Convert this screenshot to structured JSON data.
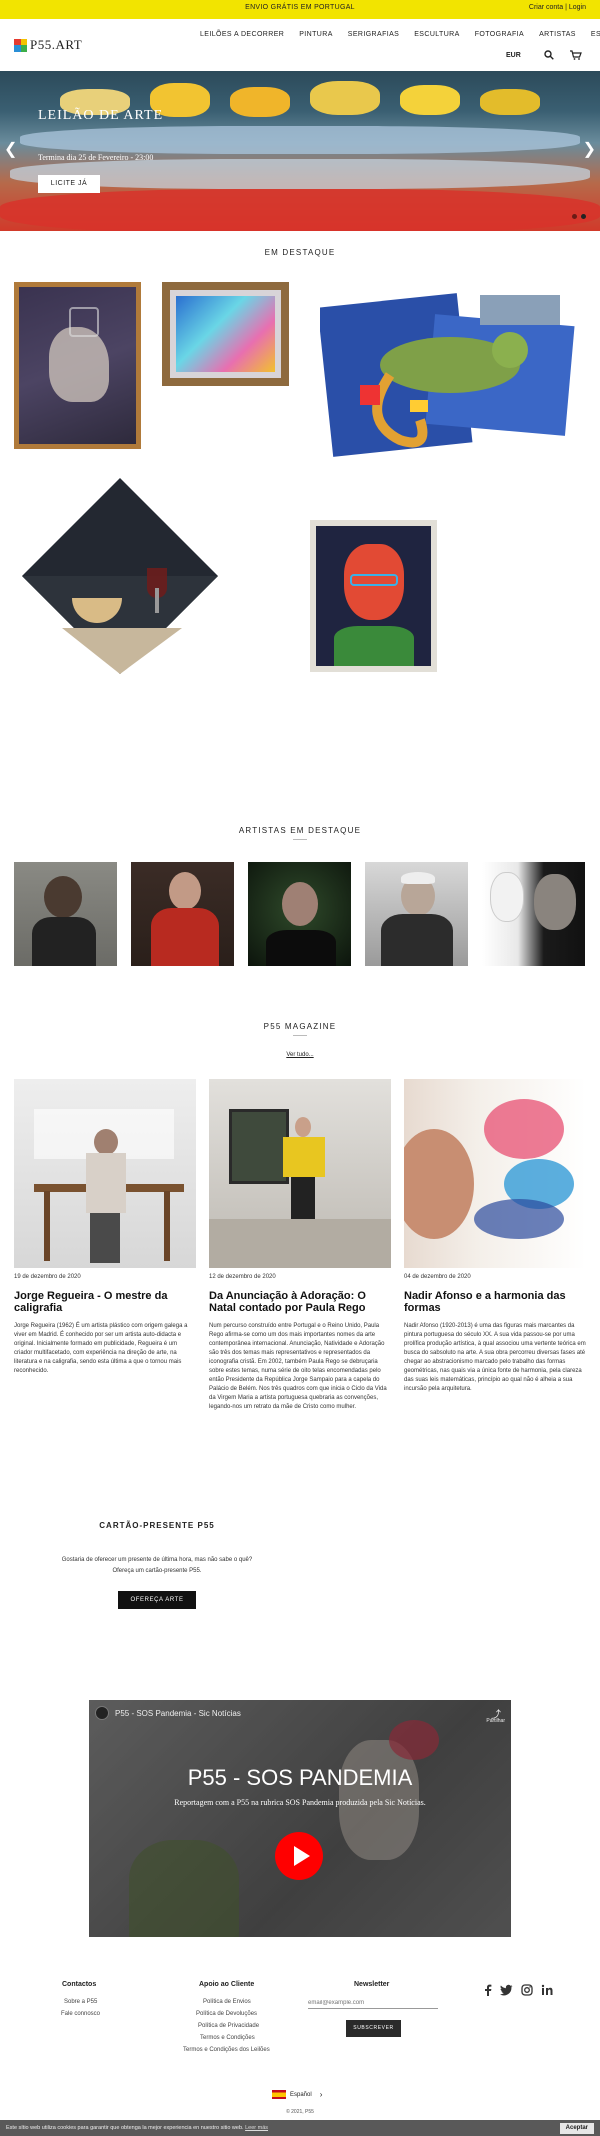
{
  "topbar": {
    "promo": "ENVIO GRÁTIS EM PORTUGAL",
    "create_account": "Criar conta",
    "separator": "|",
    "login": "Login"
  },
  "header": {
    "logo_text": "P55.ART",
    "nav": [
      "LEILÕES A DECORRER",
      "PINTURA",
      "SERIGRAFIAS",
      "ESCULTURA",
      "FOTOGRAFIA",
      "ARTISTAS",
      "ES"
    ],
    "currency": "EUR",
    "icons": [
      "search-icon",
      "cart-icon",
      "chevron-right-icon"
    ]
  },
  "hero": {
    "title": "LEILÃO DE ARTE",
    "subtitle": "Termina dia 25 de Fevereiro - 23:00",
    "button": "LICITE JÁ",
    "prev": "❮",
    "next": "❯",
    "slides": 2,
    "active_slide": 2
  },
  "featured": {
    "title": "EM DESTAQUE"
  },
  "artists": {
    "title": "ARTISTAS EM DESTAQUE"
  },
  "magazine": {
    "title": "P55 MAGAZINE",
    "see_all": "Ver tudo...",
    "articles": [
      {
        "date": "19 de dezembro de 2020",
        "title": "Jorge Regueira - O mestre da caligrafia",
        "text": "Jorge Regueira (1962) É um artista plástico com origem galega a viver em Madrid. É conhecido por ser um artista auto-didacta e original. Inicialmente formado em publicidade, Regueira é um criador multifacetado, com experiência na direção de arte, na literatura e na caligrafia, sendo esta última a que o tornou mais reconhecido."
      },
      {
        "date": "12 de dezembro de 2020",
        "title": "Da Anunciação à Adoração: O Natal contado por Paula Rego",
        "text": "Num percurso construído entre Portugal e o Reino Unido, Paula Rego afirma-se como um dos mais importantes nomes da arte contemporânea internacional. Anunciação, Natividade e Adoração são três dos temas mais representativos e representados da iconografia cristã. Em 2002, também Paula Rego se debruçaria sobre estes temas, numa série de oito telas encomendadas pelo então Presidente da República Jorge Sampaio para a capela do Palácio de Belém. Nos três quadros com que inicia o Ciclo da Vida da Virgem Maria a artista portuguesa quebraria as convenções, legando-nos um retrato da mãe de Cristo como mulher."
      },
      {
        "date": "04 de dezembro de 2020",
        "title": "Nadir Afonso e a harmonia das formas",
        "text": "Nadir Afonso (1920-2013) é uma das figuras mais marcantes da pintura portuguesa do século XX. A sua vida passou-se por uma prolífica produção artística, à qual associou uma vertente teórica em busca do sabsoluto na arte. A sua obra percorreu diversas fases até chegar ao abstracionismo marcado pelo trabalho das formas geométricas, nas quais via a única fonte de harmonia, pela clareza das suas leis matemáticas, princípio ao qual não é alheia a sua incursão pela arquitetura."
      }
    ]
  },
  "gift": {
    "title": "CARTÃO-PRESENTE P55",
    "line1": "Gostaria de oferecer um presente de última hora, mas não sabe o quê?",
    "line2": "Ofereça um cartão-presente P55.",
    "button": "OFEREÇA ARTE"
  },
  "video": {
    "channel_title": "P55 - SOS Pandemia - Sic Notícias",
    "share": "Partilhar",
    "title": "P55 - SOS PANDEMIA",
    "subtitle": "Reportagem com a P55 na rubrica SOS Pandemia produzida pela Sic Notícias."
  },
  "footer": {
    "contacts": {
      "title": "Contactos",
      "links": [
        "Sobre a P55",
        "Fale connosco"
      ]
    },
    "support": {
      "title": "Apoio ao Cliente",
      "links": [
        "Política de Envios",
        "Política de Devoluções",
        "Política de Privacidade",
        "Termos e Condições",
        "Termos e Condições dos Leilões"
      ]
    },
    "newsletter": {
      "title": "Newsletter",
      "placeholder": "email@example.com",
      "button": "SUBSCREVER"
    },
    "social": [
      "facebook-icon",
      "twitter-icon",
      "instagram-icon",
      "linkedin-icon"
    ],
    "language": "Español",
    "copyright": "© 2021, P55"
  },
  "cookie": {
    "message": "Este sítio web utiliza cookies para garantir que obtenga la mejor experiencia en nuestro sitio web.",
    "learn_more": "Leer más",
    "accept": "Aceptar"
  }
}
